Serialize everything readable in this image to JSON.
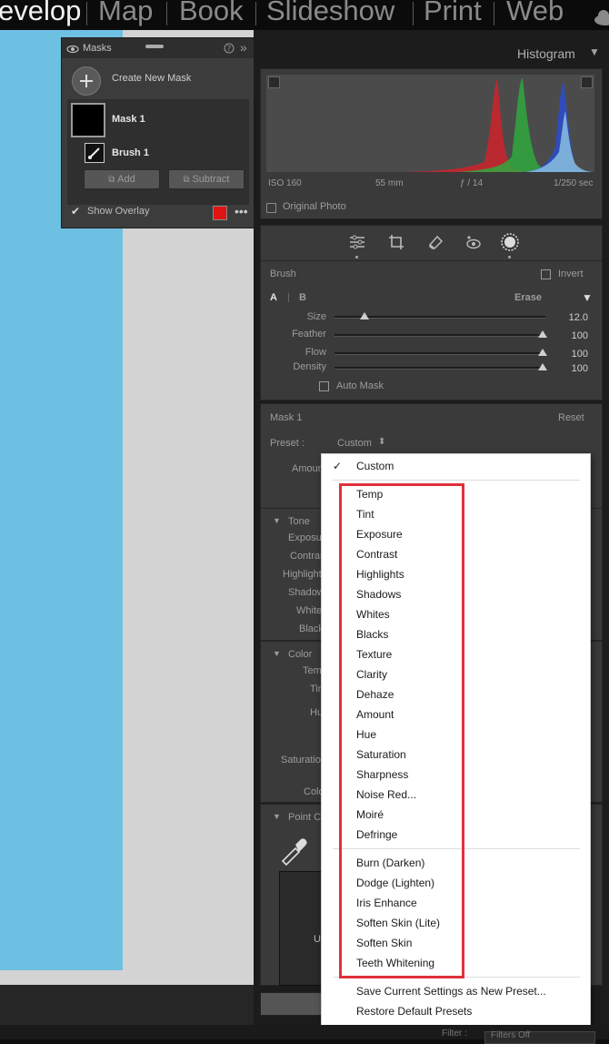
{
  "modules": {
    "develop": "evelop",
    "map": "Map",
    "book": "Book",
    "slideshow": "Slideshow",
    "print": "Print",
    "web": "Web"
  },
  "masks_panel": {
    "title": "Masks",
    "create_new_mask": "Create New Mask",
    "mask_name": "Mask 1",
    "brush_name": "Brush 1",
    "add_label": "Add",
    "subtract_label": "Subtract",
    "show_overlay": "Show Overlay",
    "overlay_color": "#e01414"
  },
  "histogram": {
    "title": "Histogram",
    "iso": "ISO 160",
    "focal": "55 mm",
    "aperture": "ƒ / 14",
    "shutter": "1/250 sec",
    "original_photo": "Original Photo"
  },
  "brush": {
    "title": "Brush",
    "invert": "Invert",
    "tab_a": "A",
    "tab_b": "B",
    "erase": "Erase",
    "sliders": [
      {
        "label": "Size",
        "value": "12.0",
        "fraction": 0.14
      },
      {
        "label": "Feather",
        "value": "100",
        "fraction": 1.0
      },
      {
        "label": "Flow",
        "value": "100",
        "fraction": 1.0
      },
      {
        "label": "Density",
        "value": "100",
        "fraction": 1.0
      }
    ],
    "auto_mask": "Auto Mask"
  },
  "mask_section": {
    "title": "Mask 1",
    "reset": "Reset",
    "preset_label": "Preset :",
    "preset_value": "Custom",
    "amount_label": "Amoun"
  },
  "tone": {
    "title": "Tone",
    "labels": [
      "Exposur",
      "Contras",
      "Highlight",
      "Shadow",
      "White",
      "Black"
    ]
  },
  "color": {
    "title": "Color",
    "labels": [
      "Tem",
      "Tir",
      "Hu",
      "Saturation",
      "Colo"
    ]
  },
  "point_color": {
    "title": "Point Co",
    "use_label": "U"
  },
  "dropdown": {
    "checked": "Custom",
    "group1": [
      "Temp",
      "Tint",
      "Exposure",
      "Contrast",
      "Highlights",
      "Shadows",
      "Whites",
      "Blacks",
      "Texture",
      "Clarity",
      "Dehaze",
      "Amount",
      "Hue",
      "Saturation",
      "Sharpness",
      "Noise Red...",
      "Moiré",
      "Defringe"
    ],
    "group2": [
      "Burn (Darken)",
      "Dodge (Lighten)",
      "Iris Enhance",
      "Soften Skin (Lite)",
      "Soften Skin",
      "Teeth Whitening"
    ],
    "save_preset": "Save Current Settings as New Preset...",
    "restore_presets": "Restore Default Presets"
  },
  "filter_bar": {
    "filter_label": "Filter :",
    "filter_value": "Filters Off"
  }
}
